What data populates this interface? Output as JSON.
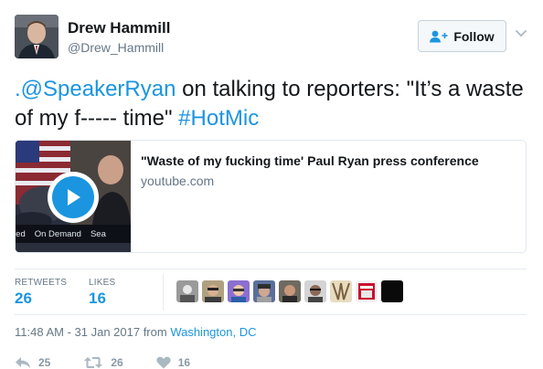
{
  "author": {
    "name": "Drew Hammill",
    "handle": "@Drew_Hammill"
  },
  "follow_button": {
    "label": "Follow"
  },
  "tweet": {
    "mention": ".@SpeakerRyan",
    "text_mid": " on talking to reporters: \"It’s a waste of my f----- time\" ",
    "hashtag": "#HotMic"
  },
  "card": {
    "title": "\"Waste of my fucking time' Paul Ryan press conference",
    "domain": "youtube.com",
    "thumb_bar": [
      "red",
      "On Demand",
      "Sea"
    ]
  },
  "stats": {
    "retweets_label": "RETWEETS",
    "retweets_value": "26",
    "likes_label": "LIKES",
    "likes_value": "16"
  },
  "likers_count_shown": 9,
  "timestamp": {
    "time": "11:48 AM - 31 Jan 2017 from ",
    "location": "Washington, DC"
  },
  "actions": {
    "reply_count": "25",
    "retweet_count": "26",
    "like_count": "16"
  },
  "icons": {
    "follow": "add-user-icon",
    "more": "chevron-down-icon",
    "play": "play-icon",
    "reply": "reply-icon",
    "retweet": "retweet-icon",
    "like": "heart-icon"
  },
  "colors": {
    "accent": "#1b95e0",
    "text": "#14171a",
    "muted": "#657786",
    "action_gray": "#aab8c2"
  }
}
